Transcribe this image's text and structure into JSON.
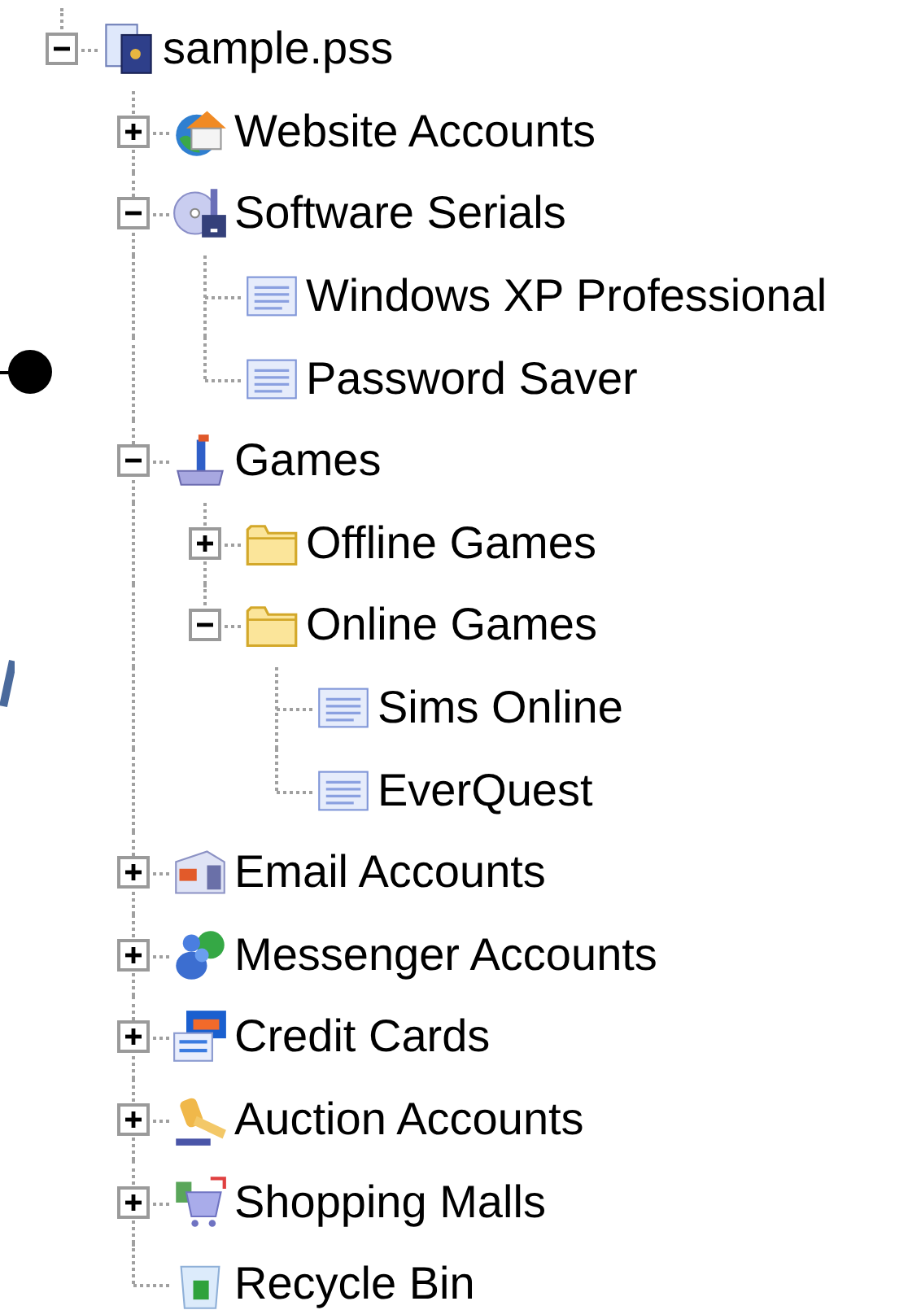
{
  "tree": {
    "label": "sample.pss",
    "kind": "file",
    "expanded": true,
    "children": [
      {
        "label": "Website Accounts",
        "kind": "house",
        "expanded": false
      },
      {
        "label": "Software Serials",
        "kind": "disc",
        "expanded": true,
        "children": [
          {
            "label": "Windows XP Professional",
            "kind": "entry"
          },
          {
            "label": "Password Saver",
            "kind": "entry"
          }
        ]
      },
      {
        "label": "Games",
        "kind": "joystick",
        "expanded": true,
        "children": [
          {
            "label": "Offline Games",
            "kind": "folder",
            "expanded": false
          },
          {
            "label": "Online Games",
            "kind": "folder",
            "expanded": true,
            "children": [
              {
                "label": "Sims Online",
                "kind": "entry"
              },
              {
                "label": "EverQuest",
                "kind": "entry"
              }
            ]
          }
        ]
      },
      {
        "label": "Email Accounts",
        "kind": "mail",
        "expanded": false
      },
      {
        "label": "Messenger Accounts",
        "kind": "people",
        "expanded": false
      },
      {
        "label": "Credit Cards",
        "kind": "card",
        "expanded": false
      },
      {
        "label": "Auction Accounts",
        "kind": "gavel",
        "expanded": false
      },
      {
        "label": "Shopping Malls",
        "kind": "cart",
        "expanded": false
      },
      {
        "label": "Recycle Bin",
        "kind": "bin"
      }
    ]
  }
}
